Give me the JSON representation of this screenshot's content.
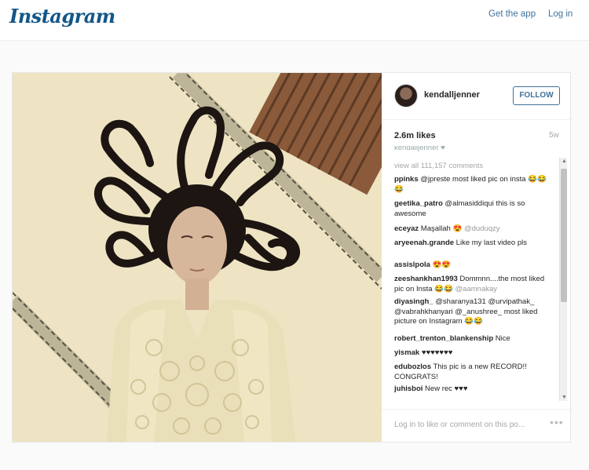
{
  "header": {
    "logo": "Instagram",
    "get_app": "Get the app",
    "login": "Log in"
  },
  "post": {
    "username": "kendalljenner",
    "follow_label": "FOLLOW",
    "likes": "2.6m likes",
    "time_ago": "5w",
    "caption_cut": "kendalljenner ♥",
    "view_all": "view all 111,157 comments",
    "comments": [
      {
        "user": "ppinks",
        "text": " @jpreste most liked pic on insta ",
        "extra": "😂😂😂"
      },
      {
        "user": "geetika_patro",
        "text": " @almasiddiqui this is so awesome",
        "extra": ""
      },
      {
        "user": "eceyaz",
        "text": " Maşallah ",
        "extra": "😍 @duduqzy"
      },
      {
        "user": "aryeenah.grande",
        "text": " Like my last video pls",
        "extra": ""
      },
      {
        "user": "assislpola",
        "text": " ",
        "extra": "😍😍"
      },
      {
        "user": "zeeshankhan1993",
        "text": " Dommnn....the most liked pic on Insta ",
        "extra": "😂😂 @aamnakay"
      },
      {
        "user": "diyasingh_",
        "text": " @sharanya131 @urvipathak_ @vabrahkhanyari @_anushree_ most liked picture on Instagram ",
        "extra": "😂😂"
      },
      {
        "user": "robert_trenton_blankenship",
        "text": " Nice",
        "extra": ""
      },
      {
        "user": "yismak",
        "text": " ♥♥♥♥♥♥♥",
        "extra": ""
      },
      {
        "user": "edubozlos",
        "text": " This pic is a new RECORD!! CONGRATS!",
        "extra": ""
      },
      {
        "user": "juhisboi",
        "text": " New rec ♥♥♥",
        "extra": ""
      }
    ],
    "login_prompt": "Log in to like or comment on this po...",
    "more_icon": "•••"
  },
  "icons": {
    "scroll_up": "▲",
    "scroll_down": "▼"
  },
  "colors": {
    "brand": "#125688",
    "link": "#3f729b",
    "muted": "#a5a7aa"
  }
}
